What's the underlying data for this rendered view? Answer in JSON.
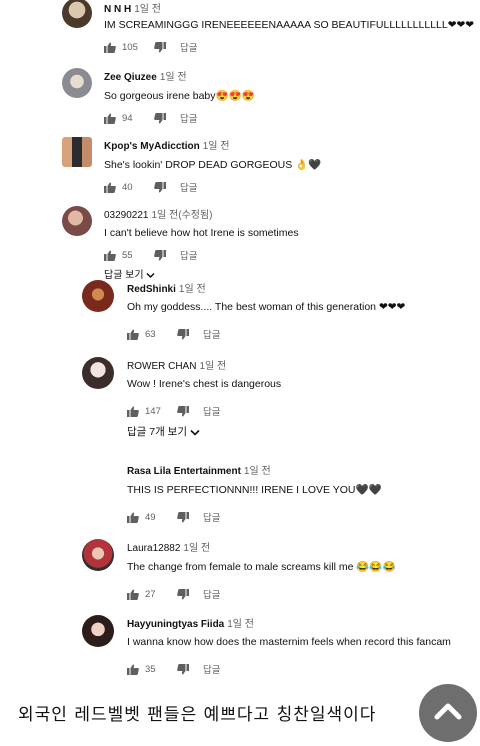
{
  "comments": [
    {
      "author": "N N H",
      "time": "1일 전",
      "text": "IM SCREAMINGGG IRENEEEEEENAAAAA SO BEAUTIFULLLLLLLLLLL❤❤❤",
      "likes": "105",
      "reply_label": "답글"
    },
    {
      "author": "Zee Qiuzee",
      "time": "1일 전",
      "text": "So gorgeous irene baby😍😍😍",
      "likes": "94",
      "reply_label": "답글"
    },
    {
      "author": "Kpop's MyAdicction",
      "time": "1일 전",
      "text": "She's lookin' DROP DEAD GORGEOUS 👌🖤",
      "likes": "40",
      "reply_label": "답글"
    },
    {
      "author": "03290221",
      "time": "1일 전(수정됨)",
      "text": "I can't believe how hot Irene is sometimes",
      "likes": "55",
      "reply_label": "답글"
    }
  ],
  "view_replies_1": "답글 보기",
  "replies": [
    {
      "author": "RedShinki",
      "time": "1일 전",
      "text": "Oh my goddess.... The best woman of this generation ❤❤❤",
      "likes": "63",
      "reply_label": "답글"
    },
    {
      "author": "ROWER CHAN",
      "time": "1일 전",
      "text": "Wow ! Irene's chest is dangerous",
      "likes": "147",
      "reply_label": "답글"
    }
  ],
  "view_replies_2": "답글 7개 보기",
  "replies2": [
    {
      "author": "Rasa Lila Entertainment",
      "time": "1일 전",
      "text": "THIS IS PERFECTIONNN!!! IRENE I LOVE YOU🖤🖤",
      "likes": "49",
      "reply_label": "답글"
    },
    {
      "author": "Laura12882",
      "time": "1일 전",
      "text": "The change from female to male screams kill me 😂😂😂",
      "likes": "27",
      "reply_label": "답글"
    },
    {
      "author": "Hayyuningtyas Fiida",
      "time": "1일 전",
      "text": "I wanna know how does the masternim feels when record this fancam",
      "likes": "35",
      "reply_label": "답글"
    }
  ],
  "caption": "외국인 레드벨벳 팬들은 예쁘다고 칭찬일색이다",
  "icons": {
    "like": "thumbs-up-icon",
    "dislike": "thumbs-down-icon",
    "expand": "chevron-down-icon",
    "scroll_top": "chevron-up-icon"
  }
}
